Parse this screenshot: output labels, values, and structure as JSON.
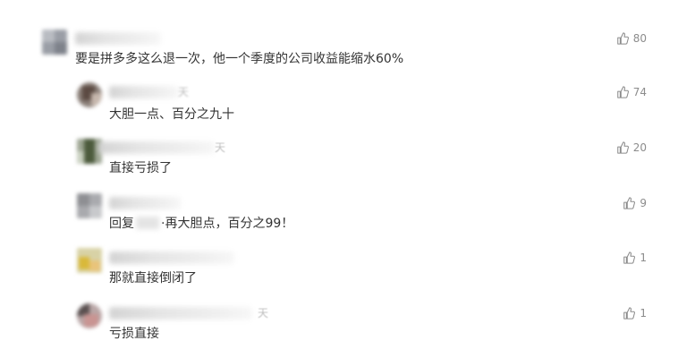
{
  "comments": [
    {
      "text": "要是拼多多这么退一次，他一个季度的公司收益能缩水60%",
      "likes": "80",
      "level": "top",
      "meta_tail": ""
    },
    {
      "text": "大胆一点、百分之九十",
      "likes": "74",
      "level": "reply",
      "meta_tail": "天"
    },
    {
      "text": "直接亏损了",
      "likes": "20",
      "level": "reply",
      "meta_tail": "天"
    },
    {
      "text_before": "回复",
      "text_after": "·再大胆点，百分之99！",
      "likes": "9",
      "level": "reply",
      "meta_tail": ""
    },
    {
      "text": "那就直接倒闭了",
      "likes": "1",
      "level": "reply",
      "meta_tail": ""
    },
    {
      "text": "亏损直接",
      "likes": "1",
      "level": "reply",
      "meta_tail": "天"
    }
  ],
  "colors": {
    "text": "#333333",
    "muted": "#8c8c8c",
    "background": "#ffffff"
  },
  "icons": {
    "like": "thumbs-up-icon"
  }
}
